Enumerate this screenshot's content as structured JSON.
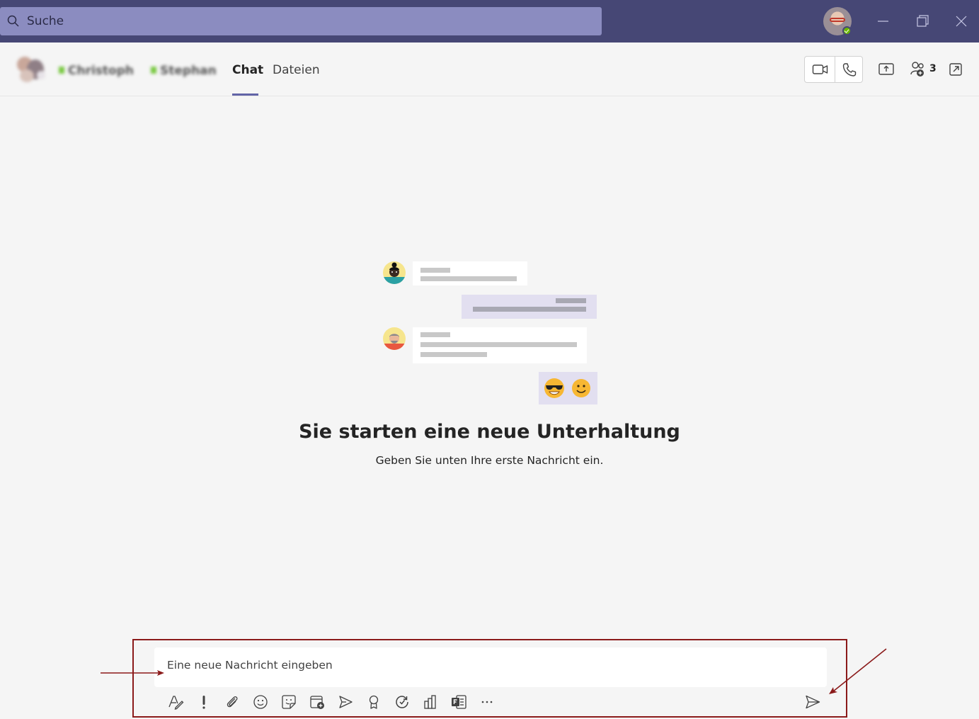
{
  "titlebar": {
    "search_placeholder": "Suche",
    "icons": [
      "search-icon",
      "minimize-icon",
      "restore-icon",
      "close-icon"
    ],
    "background": "#464775"
  },
  "header": {
    "participants": [
      "Christoph",
      "Stephan"
    ],
    "tabs": [
      {
        "label": "Chat",
        "active": true
      },
      {
        "label": "Dateien",
        "active": false
      }
    ],
    "participant_count": "3",
    "accent": "#6264a7"
  },
  "empty_state": {
    "title": "Sie starten eine neue Unterhaltung",
    "subtitle": "Geben Sie unten Ihre erste Nachricht ein."
  },
  "compose": {
    "placeholder": "Eine neue Nachricht eingeben",
    "toolbar": [
      "format-icon",
      "important-icon",
      "attach-icon",
      "emoji-icon",
      "sticker-icon",
      "schedule-meeting-icon",
      "stream-icon",
      "praise-icon",
      "loop-icon",
      "poll-icon",
      "forms-icon",
      "more-icon"
    ],
    "send_icon": "send-icon",
    "highlight_color": "#8b1a1a"
  }
}
